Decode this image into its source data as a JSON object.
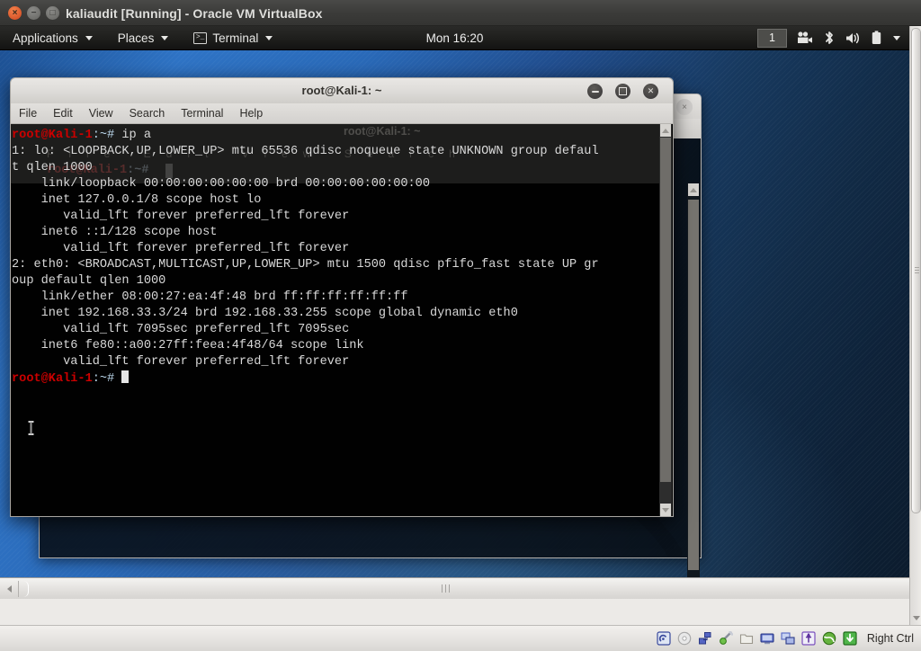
{
  "vbox": {
    "window_title": "kaliaudit [Running] - Oracle VM VirtualBox",
    "traffic": {
      "close": "×",
      "minimize": "−",
      "maximize": "□"
    },
    "status": {
      "host_key": "Right Ctrl",
      "icons": [
        "hard-disk-icon",
        "optical-disk-icon",
        "network-adapter-icon",
        "audio-icon",
        "shared-folders-icon",
        "display-icon",
        "remote-desktop-icon",
        "usb-icon",
        "globe-icon",
        "capture-indicator-icon"
      ]
    }
  },
  "gnome_panel": {
    "applications_label": "Applications",
    "places_label": "Places",
    "terminal_label": "Terminal",
    "terminal_icon": "terminal-icon",
    "clock": "Mon 16:20",
    "workspace": "1",
    "tray_icons": [
      "camera-icon",
      "bluetooth-icon",
      "volume-icon",
      "battery-icon",
      "chevron-down-icon"
    ]
  },
  "terminal": {
    "title": "root@Kali-1: ~",
    "menu": [
      "File",
      "Edit",
      "View",
      "Search",
      "Terminal",
      "Help"
    ],
    "window_buttons": {
      "minimize": "minimize-button",
      "maximize": "maximize-button",
      "close": "close-button"
    },
    "prompt_user": "root@Kali-1",
    "prompt_path": ":~# ",
    "command": "ip a",
    "lines": [
      "1: lo: <LOOPBACK,UP,LOWER_UP> mtu 65536 qdisc noqueue state UNKNOWN group defaul",
      "t qlen 1000",
      "    link/loopback 00:00:00:00:00:00 brd 00:00:00:00:00:00",
      "    inet 127.0.0.1/8 scope host lo",
      "       valid_lft forever preferred_lft forever",
      "    inet6 ::1/128 scope host ",
      "       valid_lft forever preferred_lft forever",
      "2: eth0: <BROADCAST,MULTICAST,UP,LOWER_UP> mtu 1500 qdisc pfifo_fast state UP gr",
      "oup default qlen 1000",
      "    link/ether 08:00:27:ea:4f:48 brd ff:ff:ff:ff:ff:ff",
      "    inet 192.168.33.3/24 brd 192.168.33.255 scope global dynamic eth0",
      "       valid_lft 7095sec preferred_lft 7095sec",
      "    inet6 fe80::a00:27ff:feea:4f48/64 scope link ",
      "       valid_lft forever preferred_lft forever"
    ]
  },
  "background_terminal": {
    "title": "root@Kali-1: ~",
    "menu": [
      "File",
      "Edit",
      "View",
      "Search",
      "Terminal",
      "Help"
    ],
    "close_glyph": "×",
    "prompt_user": "root@Kali-1",
    "prompt_path": ":~#"
  },
  "colors": {
    "prompt_red": "#cc0000",
    "prompt_blue": "#b8d4e8",
    "terminal_bg": "#010101",
    "terminal_fg": "#d8d8d8",
    "wallpaper_blue": "#2f74c6",
    "vbox_titlebar": "#3b3b39",
    "close_button_orange": "#d8552a"
  }
}
